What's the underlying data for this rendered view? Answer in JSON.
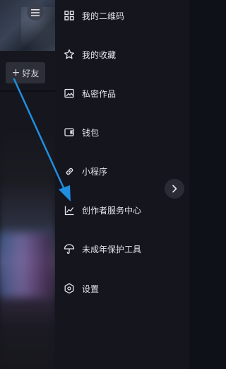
{
  "header": {
    "menu_icon": "hamburger-icon"
  },
  "profile": {
    "add_friend_label": "好友",
    "add_friend_icon": "plus-icon"
  },
  "drawer": {
    "items": [
      {
        "label": "我的二维码",
        "icon": "qr-code-icon"
      },
      {
        "label": "我的收藏",
        "icon": "star-icon"
      },
      {
        "label": "私密作品",
        "icon": "private-works-icon"
      },
      {
        "label": "钱包",
        "icon": "wallet-icon"
      },
      {
        "label": "小程序",
        "icon": "link-icon"
      },
      {
        "label": "创作者服务中心",
        "icon": "chart-line-icon"
      },
      {
        "label": "未成年保护工具",
        "icon": "umbrella-icon"
      },
      {
        "label": "设置",
        "icon": "settings-hexagon-icon"
      }
    ],
    "expand_icon": "chevron-right-icon"
  },
  "annotation": {
    "arrow_color": "#1e8fe0"
  },
  "colors": {
    "drawer_bg": "#14151d",
    "text": "#e4e4ea",
    "accent_arrow": "#1e8fe0"
  }
}
